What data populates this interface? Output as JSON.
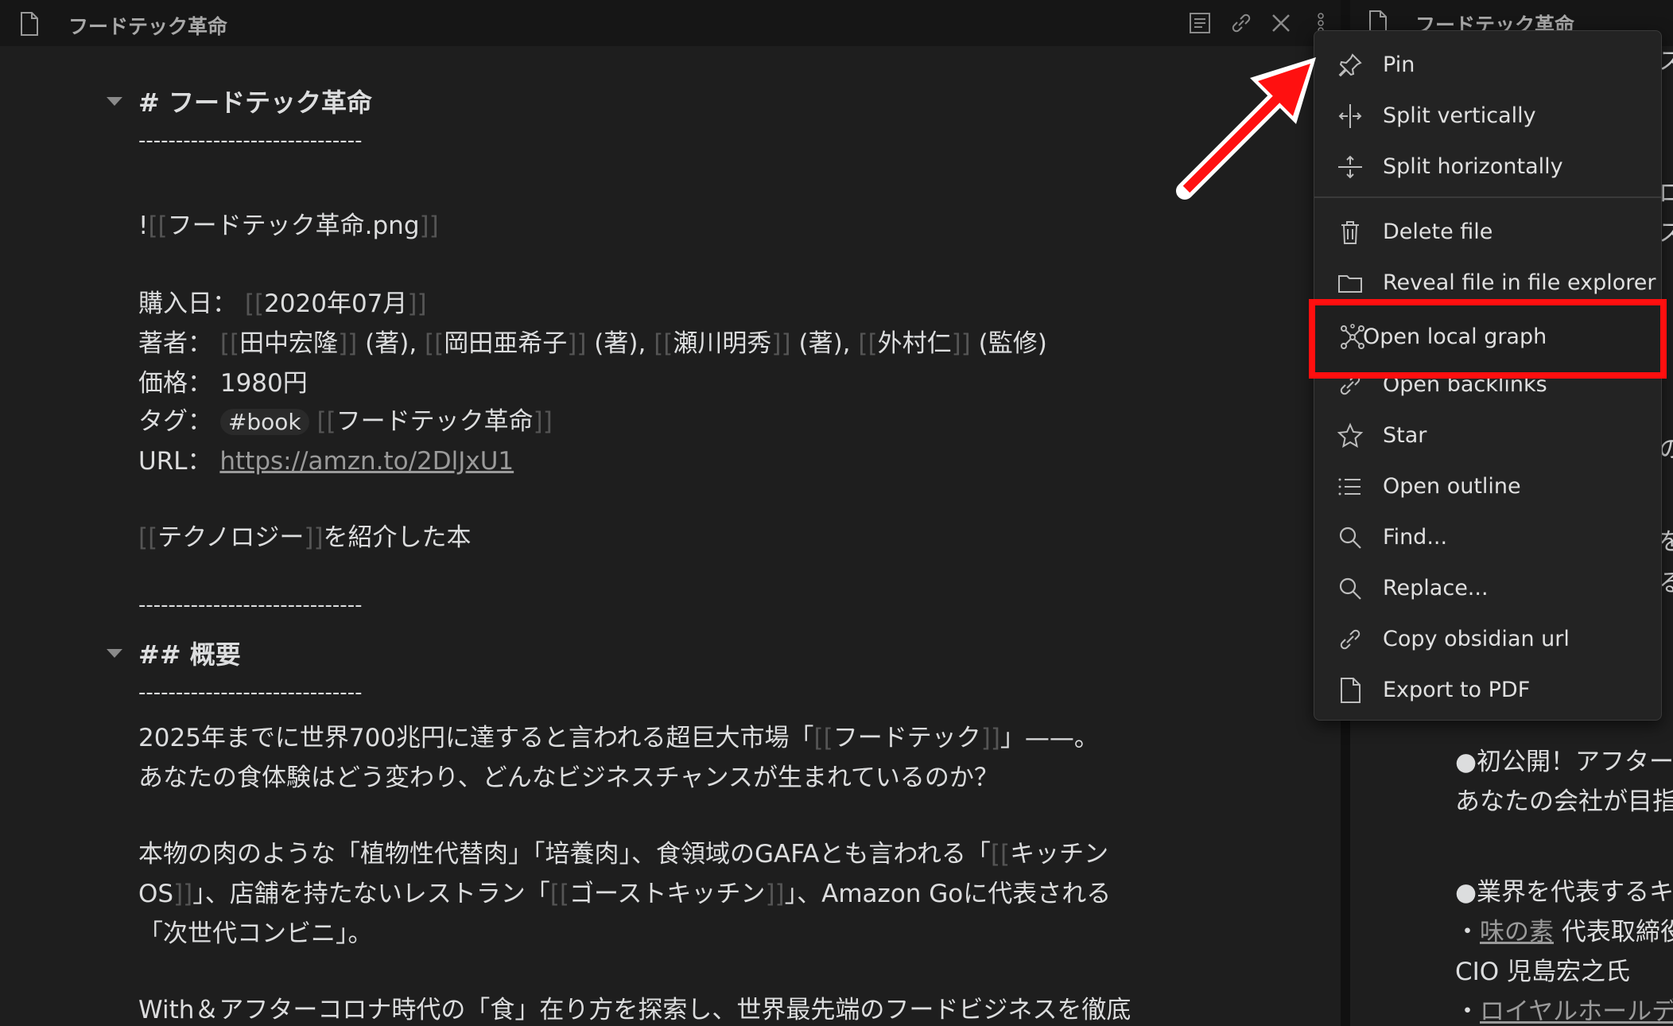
{
  "left_pane": {
    "title": "フードテック革命",
    "lines": {
      "h1": "# フードテック革命",
      "hr1": "------------------------------",
      "embed_bang": "!",
      "embed_open": "[[",
      "embed_text": "フードテック革命.png",
      "embed_close": "]]",
      "purchase_label": "購入日：",
      "purchase_open": "[[",
      "purchase_value": "2020年07月",
      "purchase_close": "]]",
      "author_label": "著者：",
      "a1_open": "[[",
      "a1": "田中宏隆",
      "a1_close": "]]",
      "a1_role": "(著),",
      "a2_open": "[[",
      "a2": "岡田亜希子",
      "a2_close": "]]",
      "a2_role": "(著),",
      "a3_open": "[[",
      "a3": "瀬川明秀",
      "a3_close": "]]",
      "a3_role": "(著),",
      "a4_open": "[[",
      "a4": "外村仁",
      "a4_close": "]]",
      "a4_role": "(監修)",
      "price_label": "価格：",
      "price_value": "1980円",
      "tag_label": "タグ：",
      "tag_value": "#book",
      "tag_link_open": "[[",
      "tag_link": "フードテック革命",
      "tag_link_close": "]]",
      "url_label": "URL：",
      "url_value": "https://amzn.to/2DlJxU1",
      "tech_open": "[[",
      "tech_link": "テクノロジー",
      "tech_close": "]]",
      "tech_rest": "を紹介した本",
      "hr2": "------------------------------",
      "h2": "## 概要",
      "hr3": "------------------------------",
      "p1a_pre": "2025年までに世界700兆円に達すると言われる超巨大市場「",
      "p1a_open": "[[",
      "p1a_link": "フードテック",
      "p1a_close": "]]",
      "p1a_post": "」——。",
      "p1b": "あなたの食体験はどう変わり、どんなビジネスチャンスが生まれているのか？",
      "p2a_pre": "本物の肉のような「植物性代替肉」「培養肉」、食領域のGAFAとも言われる「",
      "p2a_open": "[[",
      "p2a_link": "キッチン",
      "p2b_link": "OS",
      "p2b_close": "]]",
      "p2b_mid": "」、店舗を持たないレストラン「",
      "p2b_open": "[[",
      "p2b_link2": "ゴーストキッチン",
      "p2b_close2": "]]",
      "p2b_post": "」、Amazon Goに代表される",
      "p2c": "「次世代コンビニ」。",
      "p3": "With＆アフターコロナ時代の「食」在り方を探索し、世界最先端のフードビジネスを徹底"
    }
  },
  "right_pane": {
    "title": "フードテック革命",
    "edge_chars": [
      "ス",
      "ロ",
      "ス",
      "の",
      "を",
      "る"
    ],
    "l1": "●初公開！アフター",
    "l2": "あなたの会社が目指",
    "l3": "●業界を代表するキ",
    "l4_pre": "・",
    "l4_link": "味の素",
    "l4_post": " 代表取締役",
    "l5": "CIO 児島宏之氏",
    "l6_pre": "・",
    "l6_link": "ロイヤルホールデ"
  },
  "menu": {
    "items": [
      {
        "label": "Pin",
        "icon": "pin-icon"
      },
      {
        "label": "Split vertically",
        "icon": "split-vertical-icon"
      },
      {
        "label": "Split horizontally",
        "icon": "split-horizontal-icon"
      },
      {
        "label": "Delete file",
        "icon": "trash-icon"
      },
      {
        "label": "Reveal file in file explorer",
        "icon": "folder-icon"
      },
      {
        "label": "Open local graph",
        "icon": "graph-icon"
      },
      {
        "label": "Open backlinks",
        "icon": "link-icon"
      },
      {
        "label": "Star",
        "icon": "star-icon"
      },
      {
        "label": "Open outline",
        "icon": "list-icon"
      },
      {
        "label": "Find...",
        "icon": "search-icon"
      },
      {
        "label": "Replace...",
        "icon": "search-icon"
      },
      {
        "label": "Copy obsidian url",
        "icon": "link-icon"
      },
      {
        "label": "Export to PDF",
        "icon": "file-icon"
      }
    ]
  },
  "colors": {
    "background": "#1e1e1e",
    "highlight": "#ff0f0f"
  }
}
